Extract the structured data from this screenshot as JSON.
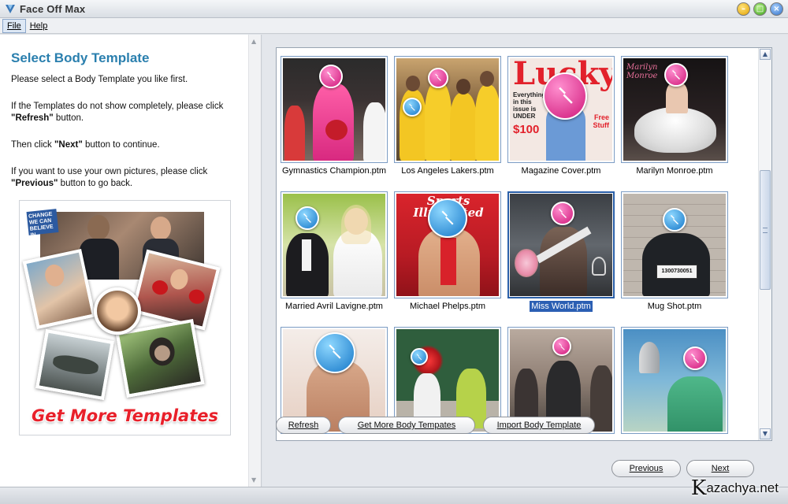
{
  "window": {
    "title": "Face Off Max"
  },
  "menu": {
    "file": "File",
    "help": "Help"
  },
  "left": {
    "title": "Select Body Template",
    "p1": "Please select a Body Template you like first.",
    "p2_pre": "If the Templates do not show completely, please click ",
    "p2_bold": "\"Refresh\"",
    "p2_post": " button.",
    "p3_pre": "Then click ",
    "p3_bold": "\"Next\"",
    "p3_post": " button to continue.",
    "p4_pre": "If you want to use your own pictures, please click ",
    "p4_bold": "\"Previous\"",
    "p4_post": " button to go back.",
    "promo_text": "Get More Templates",
    "promo_badge": "CHANGE WE CAN BELIEVE IN"
  },
  "gallery": {
    "templates": [
      {
        "label": "Gymnastics Champion.ptm",
        "icon": "pink",
        "selected": false
      },
      {
        "label": "Los Angeles Lakers.ptm",
        "icon": "mixed",
        "selected": false
      },
      {
        "label": "Magazine Cover.ptm",
        "icon": "pink",
        "selected": false
      },
      {
        "label": "Marilyn Monroe.ptm",
        "icon": "pink",
        "selected": false
      },
      {
        "label": "Married Avril Lavigne.ptm",
        "icon": "blue",
        "selected": false
      },
      {
        "label": "Michael Phelps.ptm",
        "icon": "blue",
        "selected": false
      },
      {
        "label": "Miss World.ptm",
        "icon": "pink",
        "selected": true
      },
      {
        "label": "Mug Shot.ptm",
        "icon": "blue",
        "selected": false
      },
      {
        "label": "",
        "icon": "blue",
        "selected": false
      },
      {
        "label": "",
        "icon": "blue",
        "selected": false
      },
      {
        "label": "",
        "icon": "pink",
        "selected": false
      },
      {
        "label": "",
        "icon": "pink",
        "selected": false
      }
    ],
    "magazine_title": "Lucky",
    "magazine_line1": "Everything in this issue is UNDER",
    "magazine_price": "$100",
    "magazine_side": "Free Stuff",
    "si_title": "Sports Illustrated",
    "mug_number": "1300730051",
    "marilyn_text": "Marilyn Monroe"
  },
  "buttons": {
    "refresh": "Refresh",
    "get_more": "Get More Body Tempates",
    "import": "Import Body Template",
    "previous": "Previous",
    "next": "Next"
  },
  "watermark": {
    "big": "K",
    "text": "azachya.net"
  },
  "colors": {
    "accent": "#2a7fae",
    "promo_red": "#e8202a",
    "selection": "#2b5fb3"
  }
}
